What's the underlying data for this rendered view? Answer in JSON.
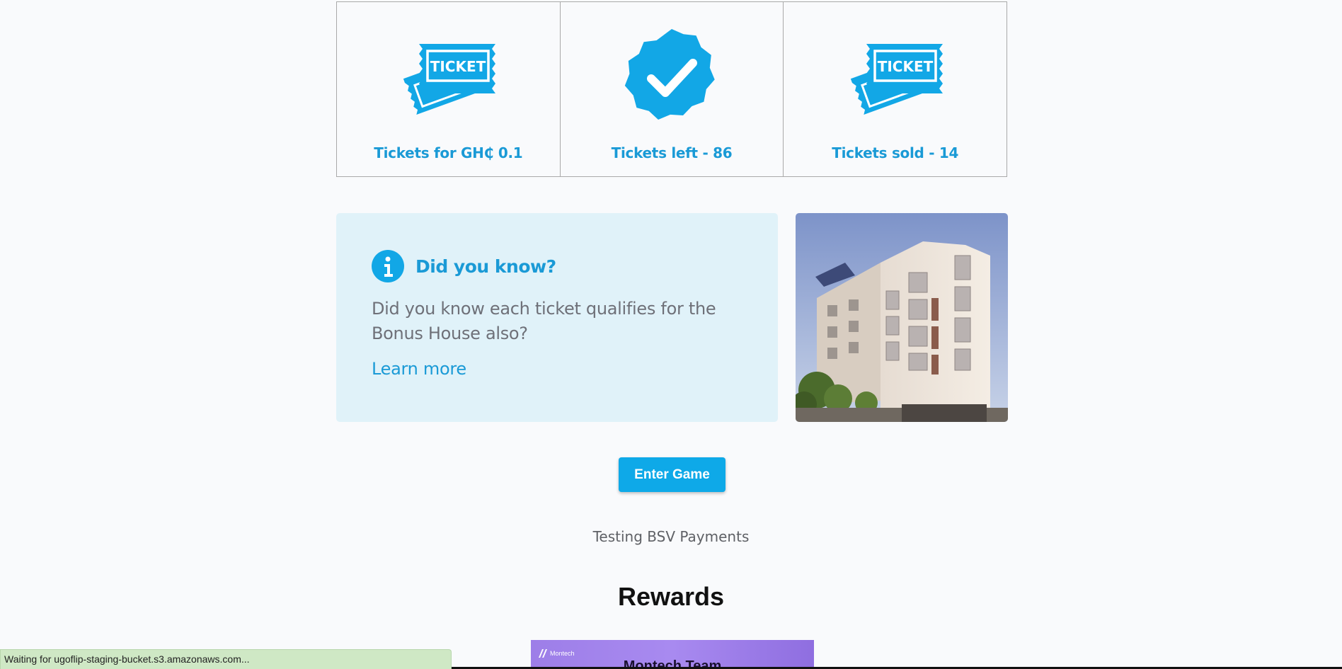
{
  "stats": [
    {
      "icon": "ticket-icon",
      "badge": "TICKET",
      "label": "Tickets for GH₵ 0.1"
    },
    {
      "icon": "verified-check-icon",
      "label": "Tickets left - 86"
    },
    {
      "icon": "ticket-icon",
      "badge": "TICKET",
      "label": "Tickets sold - 14"
    }
  ],
  "info": {
    "icon": "info-icon",
    "title": "Did you know?",
    "body": "Did you know each ticket qualifies for the Bonus House also?",
    "link": "Learn more"
  },
  "house_image": {
    "icon": "house-photo"
  },
  "enter_button": "Enter Game",
  "game_name": "Testing BSV Payments",
  "rewards": {
    "title": "Rewards",
    "card_logo": "Montech",
    "card_title": "Montech Team"
  },
  "status_bar": "Waiting for ugoflip-staging-bucket.s3.amazonaws.com...",
  "colors": {
    "accent": "#12a7e6",
    "link": "#1a9ad6",
    "info_bg": "#e0f2f9",
    "status_bg": "#cfe8c5"
  }
}
